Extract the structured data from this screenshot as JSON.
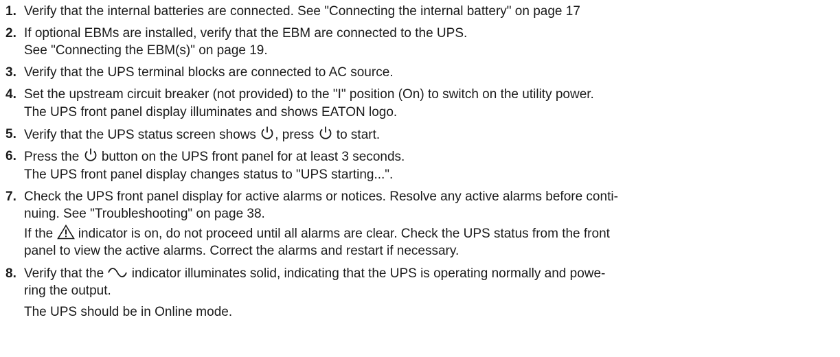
{
  "steps": [
    {
      "num": "1.",
      "lines": [
        {
          "text": "Verify that the internal batteries are connected. See \"Connecting the internal battery\" on page 17"
        }
      ]
    },
    {
      "num": "2.",
      "lines": [
        {
          "text": "If optional EBMs are installed, verify that the EBM are connected to the UPS."
        },
        {
          "text": "See \"Connecting the EBM(s)\" on page 19."
        }
      ]
    },
    {
      "num": "3.",
      "lines": [
        {
          "text": "Verify that the UPS terminal blocks are connected to AC source."
        }
      ]
    },
    {
      "num": "4.",
      "lines": [
        {
          "text": "Set the upstream circuit breaker (not provided) to the \"I\" position (On) to switch on the utility power."
        },
        {
          "text": "The UPS front panel display illuminates and shows EATON logo."
        }
      ]
    },
    {
      "num": "5.",
      "lines": [
        {
          "a": "Verify that the UPS status screen shows ",
          "b": ", press ",
          "c": " to start."
        }
      ]
    },
    {
      "num": "6.",
      "lines": [
        {
          "a": "Press the ",
          "b": " button on the UPS front panel for at least 3 seconds."
        },
        {
          "text": "The UPS front panel display changes status to \"UPS starting...\"."
        }
      ]
    },
    {
      "num": "7.",
      "lines": [
        {
          "text": "Check the UPS front panel display for active alarms or notices. Resolve any active alarms before conti-"
        },
        {
          "text": "nuing. See \"Troubleshooting\" on page 38."
        },
        {
          "a": "If the ",
          "b": " indicator is on, do not proceed until all alarms are clear. Check the UPS status from the front"
        },
        {
          "text": "panel to view the active alarms. Correct the alarms and restart if necessary."
        }
      ]
    },
    {
      "num": "8.",
      "lines": [
        {
          "a": "Verify that the ",
          "b": " indicator illuminates solid, indicating that the UPS is operating normally and powe-"
        },
        {
          "text": "ring the output."
        },
        {
          "text": "The UPS should be in Online mode."
        }
      ]
    }
  ],
  "icons": {
    "power": "power-icon",
    "warning": "warning-triangle-icon",
    "sine": "sine-wave-icon"
  }
}
